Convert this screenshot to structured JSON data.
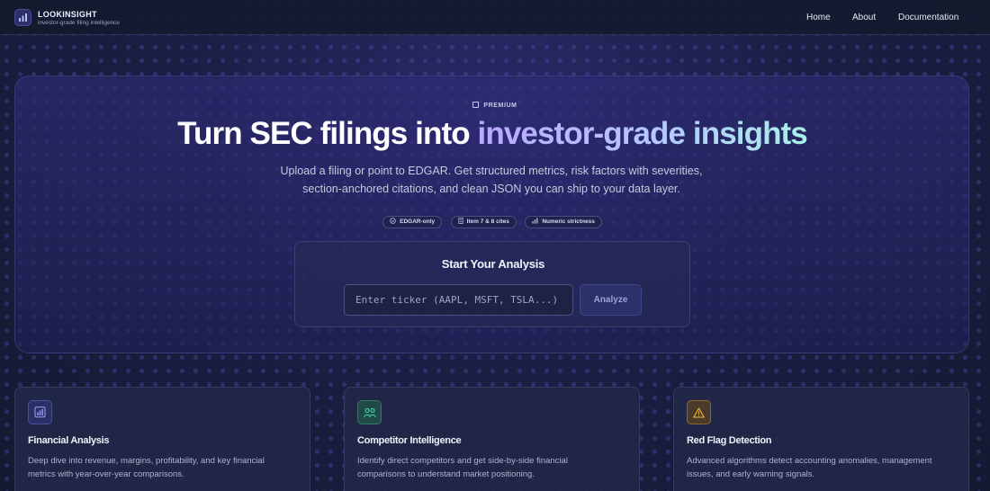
{
  "brand": {
    "name": "LOOKINSIGHT",
    "tagline": "investor-grade filing intelligence"
  },
  "nav": {
    "items": [
      "Home",
      "About",
      "Documentation"
    ]
  },
  "hero": {
    "badge": "PREMIUM",
    "headline_main": "Turn SEC filings into",
    "headline_accent": "investor-grade insights",
    "subtitle": "Upload a filing or point to EDGAR. Get structured metrics, risk factors with severities, section-anchored citations, and clean JSON you can ship to your data layer.",
    "chips": [
      {
        "icon": "check-circle-icon",
        "label": "EDGAR-only"
      },
      {
        "icon": "document-icon",
        "label": "Item 7 & 8 cites"
      },
      {
        "icon": "bar-chart-icon",
        "label": "Numeric strictness"
      }
    ]
  },
  "analysis": {
    "title": "Start Your Analysis",
    "input_placeholder": "Enter ticker (AAPL, MSFT, TSLA...)",
    "input_value": "",
    "button_label": "Analyze"
  },
  "features": [
    {
      "icon": "bar-chart-icon",
      "accent": "#7b82ff",
      "title": "Financial Analysis",
      "description": "Deep dive into revenue, margins, profitability, and key financial metrics with year-over-year comparisons."
    },
    {
      "icon": "users-icon",
      "accent": "#3fd6a0",
      "title": "Competitor Intelligence",
      "description": "Identify direct competitors and get side-by-side financial comparisons to understand market positioning."
    },
    {
      "icon": "warning-icon",
      "accent": "#f2b93b",
      "title": "Red Flag Detection",
      "description": "Advanced algorithms detect accounting anomalies, management issues, and early warning signals."
    }
  ],
  "colors": {
    "background": "#141a33",
    "hero_panel": "#2a2a6a",
    "accent_gradient": [
      "#b9a8ff",
      "#b6c8ff",
      "#a8f0e6"
    ]
  }
}
